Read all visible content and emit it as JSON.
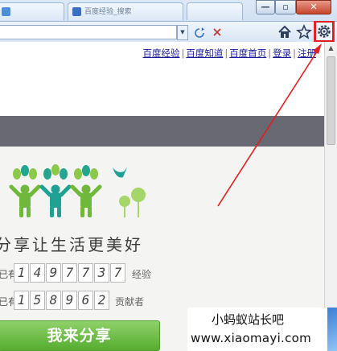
{
  "browser": {
    "tabs": [
      {
        "label": "",
        "active": false
      },
      {
        "label": "百度经验_搜索",
        "active": true
      },
      {
        "label": "",
        "active": false
      }
    ],
    "window_buttons": {
      "minimize": "—",
      "maximize": "▫",
      "close": "✕"
    },
    "nav_icons": [
      "home-icon",
      "star-icon",
      "gear-icon"
    ]
  },
  "page": {
    "top_links": [
      "百度经验",
      "百度知道",
      "百度首页",
      "登录",
      "注册"
    ],
    "slogan": "分享让生活更美好",
    "stats": [
      {
        "prefix": "已有",
        "digits": [
          "1",
          "4",
          "9",
          "7",
          "7",
          "3",
          "7"
        ],
        "suffix": "经验"
      },
      {
        "prefix": "已有",
        "digits": [
          "1",
          "5",
          "8",
          "9",
          "6",
          "2"
        ],
        "suffix": "贡献者"
      }
    ],
    "share_button": "我来分享",
    "colors": {
      "accent_green": "#56ad2f",
      "gray_bar": "#676872",
      "annotation_red": "#e02020"
    }
  },
  "watermark": {
    "line1": "小蚂蚁站长吧",
    "line2": "www.xiaomayi.com"
  }
}
